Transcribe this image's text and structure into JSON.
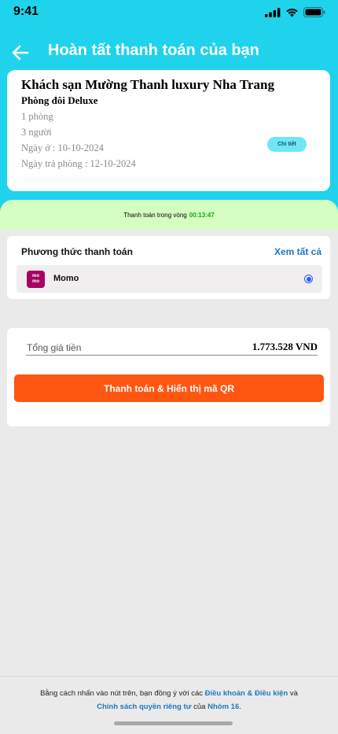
{
  "status_bar": {
    "time": "9:41"
  },
  "header": {
    "title": "Hoàn tất thanh toán của bạn"
  },
  "booking": {
    "hotel_name": "Khách sạn Mường Thanh luxury Nha Trang",
    "room_type": "Phòng đôi Deluxe",
    "rooms": "1 phòng",
    "guests": "3 người",
    "check_in": "Ngày ở : 10-10-2024",
    "check_out": "Ngày trả phòng : 12-10-2024",
    "detail_label": "Chi tiết"
  },
  "timer": {
    "label": "Thanh toán trong vòng",
    "value": "00:13:47"
  },
  "payment": {
    "title": "Phương thức thanh toán",
    "see_all": "Xem tất cả",
    "method": {
      "logo_line1": "mo",
      "logo_line2": "mo",
      "name": "Momo",
      "selected": true
    }
  },
  "total": {
    "label": "Tổng giá tiền",
    "value": "1.773.528 VND",
    "button_label": "Thanh toán & Hiển thị mã QR"
  },
  "footer": {
    "text_before": "Bằng cách nhấn vào nút trên, bạn đồng ý với các ",
    "terms_link": "Điều khoản & Điều kiện",
    "text_and": " và",
    "privacy_link": "Chính sách quyền riêng tư",
    "text_of": " của ",
    "group_link": "Nhóm 16",
    "text_end": "."
  },
  "colors": {
    "header": "#1fd3ec",
    "timer_band": "#d4ffc1",
    "primary_button": "#ff5611",
    "link": "#1e77c0",
    "momo": "#a50064"
  },
  "icons": [
    "signal-icon",
    "wifi-icon",
    "battery-icon",
    "back-arrow-icon",
    "radio-selected-icon"
  ]
}
